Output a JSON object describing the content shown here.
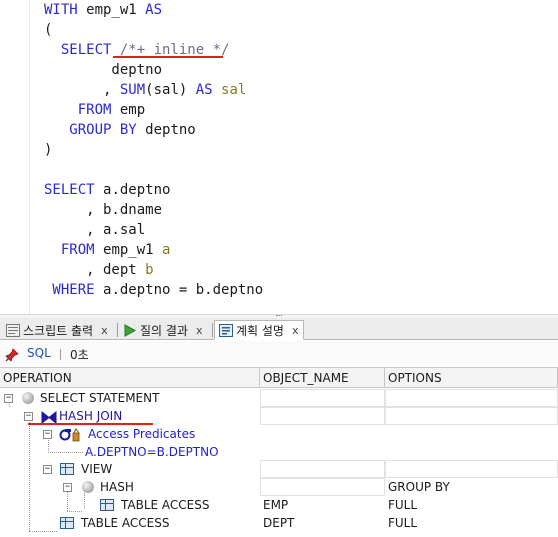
{
  "editor": {
    "lines": [
      {
        "id": "l1",
        "parts": [
          {
            "t": "WITH",
            "c": "kw"
          },
          {
            "t": " emp_w1 ",
            "c": "pl"
          },
          {
            "t": "AS",
            "c": "kw"
          }
        ]
      },
      {
        "id": "l2",
        "parts": [
          {
            "t": "(",
            "c": "pl"
          }
        ]
      },
      {
        "id": "l3",
        "parts": [
          {
            "t": "  SELECT ",
            "c": "kw"
          },
          {
            "t": "/*+ inline */",
            "c": "cm"
          }
        ]
      },
      {
        "id": "l4",
        "parts": [
          {
            "t": "        deptno",
            "c": "pl"
          }
        ]
      },
      {
        "id": "l5",
        "parts": [
          {
            "t": "       , ",
            "c": "pl"
          },
          {
            "t": "SUM",
            "c": "fn"
          },
          {
            "t": "(sal) ",
            "c": "pl"
          },
          {
            "t": "AS",
            "c": "kw"
          },
          {
            "t": " sal",
            "c": "al"
          }
        ]
      },
      {
        "id": "l6",
        "parts": [
          {
            "t": "    FROM ",
            "c": "kw"
          },
          {
            "t": "emp",
            "c": "pl"
          }
        ]
      },
      {
        "id": "l7",
        "parts": [
          {
            "t": "   GROUP BY ",
            "c": "kw"
          },
          {
            "t": "deptno",
            "c": "pl"
          }
        ]
      },
      {
        "id": "l8",
        "parts": [
          {
            "t": ")",
            "c": "pl"
          }
        ]
      },
      {
        "id": "l9",
        "parts": [
          {
            "t": "",
            "c": "pl"
          }
        ]
      },
      {
        "id": "l10",
        "parts": [
          {
            "t": "SELECT ",
            "c": "kw"
          },
          {
            "t": "a.deptno",
            "c": "pl"
          }
        ]
      },
      {
        "id": "l11",
        "parts": [
          {
            "t": "     , b.dname",
            "c": "pl"
          }
        ]
      },
      {
        "id": "l12",
        "parts": [
          {
            "t": "     , a.sal",
            "c": "pl"
          }
        ]
      },
      {
        "id": "l13",
        "parts": [
          {
            "t": "  FROM ",
            "c": "kw"
          },
          {
            "t": "emp_w1 ",
            "c": "pl"
          },
          {
            "t": "a",
            "c": "al"
          }
        ]
      },
      {
        "id": "l14",
        "parts": [
          {
            "t": "     , dept ",
            "c": "pl"
          },
          {
            "t": "b",
            "c": "al"
          }
        ]
      },
      {
        "id": "l15",
        "parts": [
          {
            "t": " WHERE ",
            "c": "kw"
          },
          {
            "t": "a.deptno = b.deptno",
            "c": "pl"
          }
        ]
      }
    ]
  },
  "tabs": [
    {
      "label": "스크립트 출력",
      "close": "x",
      "icon": "script-output-icon"
    },
    {
      "label": "질의 결과",
      "close": "x",
      "icon": "query-result-icon"
    },
    {
      "label": "계획 설명",
      "close": "x",
      "icon": "explain-plan-icon",
      "active": true
    }
  ],
  "toolbar": {
    "sql_label": "SQL",
    "time_label": "0초",
    "pin_icon": "pin-icon"
  },
  "grid": {
    "columns": [
      "OPERATION",
      "OBJECT_NAME",
      "OPTIONS"
    ],
    "rows": [
      {
        "operation": "SELECT STATEMENT",
        "object": "",
        "options": "",
        "icon": "ball-icon"
      },
      {
        "operation": "HASH JOIN",
        "object": "",
        "options": "",
        "icon": "hash-join-icon"
      },
      {
        "operation": "Access Predicates",
        "object": "",
        "options": "",
        "icon": "access-predicates-icon"
      },
      {
        "operation": "A.DEPTNO=B.DEPTNO",
        "object": "",
        "options": ""
      },
      {
        "operation": "VIEW",
        "object": "",
        "options": "",
        "icon": "view-icon"
      },
      {
        "operation": "HASH",
        "object": "",
        "options": "GROUP BY",
        "icon": "ball-icon"
      },
      {
        "operation": "TABLE ACCESS",
        "object": "EMP",
        "options": "FULL",
        "icon": "table-icon"
      },
      {
        "operation": "TABLE ACCESS",
        "object": "DEPT",
        "options": "FULL",
        "icon": "table-icon"
      }
    ]
  },
  "colors": {
    "keyword": "#2a2ad0",
    "comment": "#6d6d8c",
    "alias": "#8a7a20",
    "annotation": "#e0201e"
  }
}
